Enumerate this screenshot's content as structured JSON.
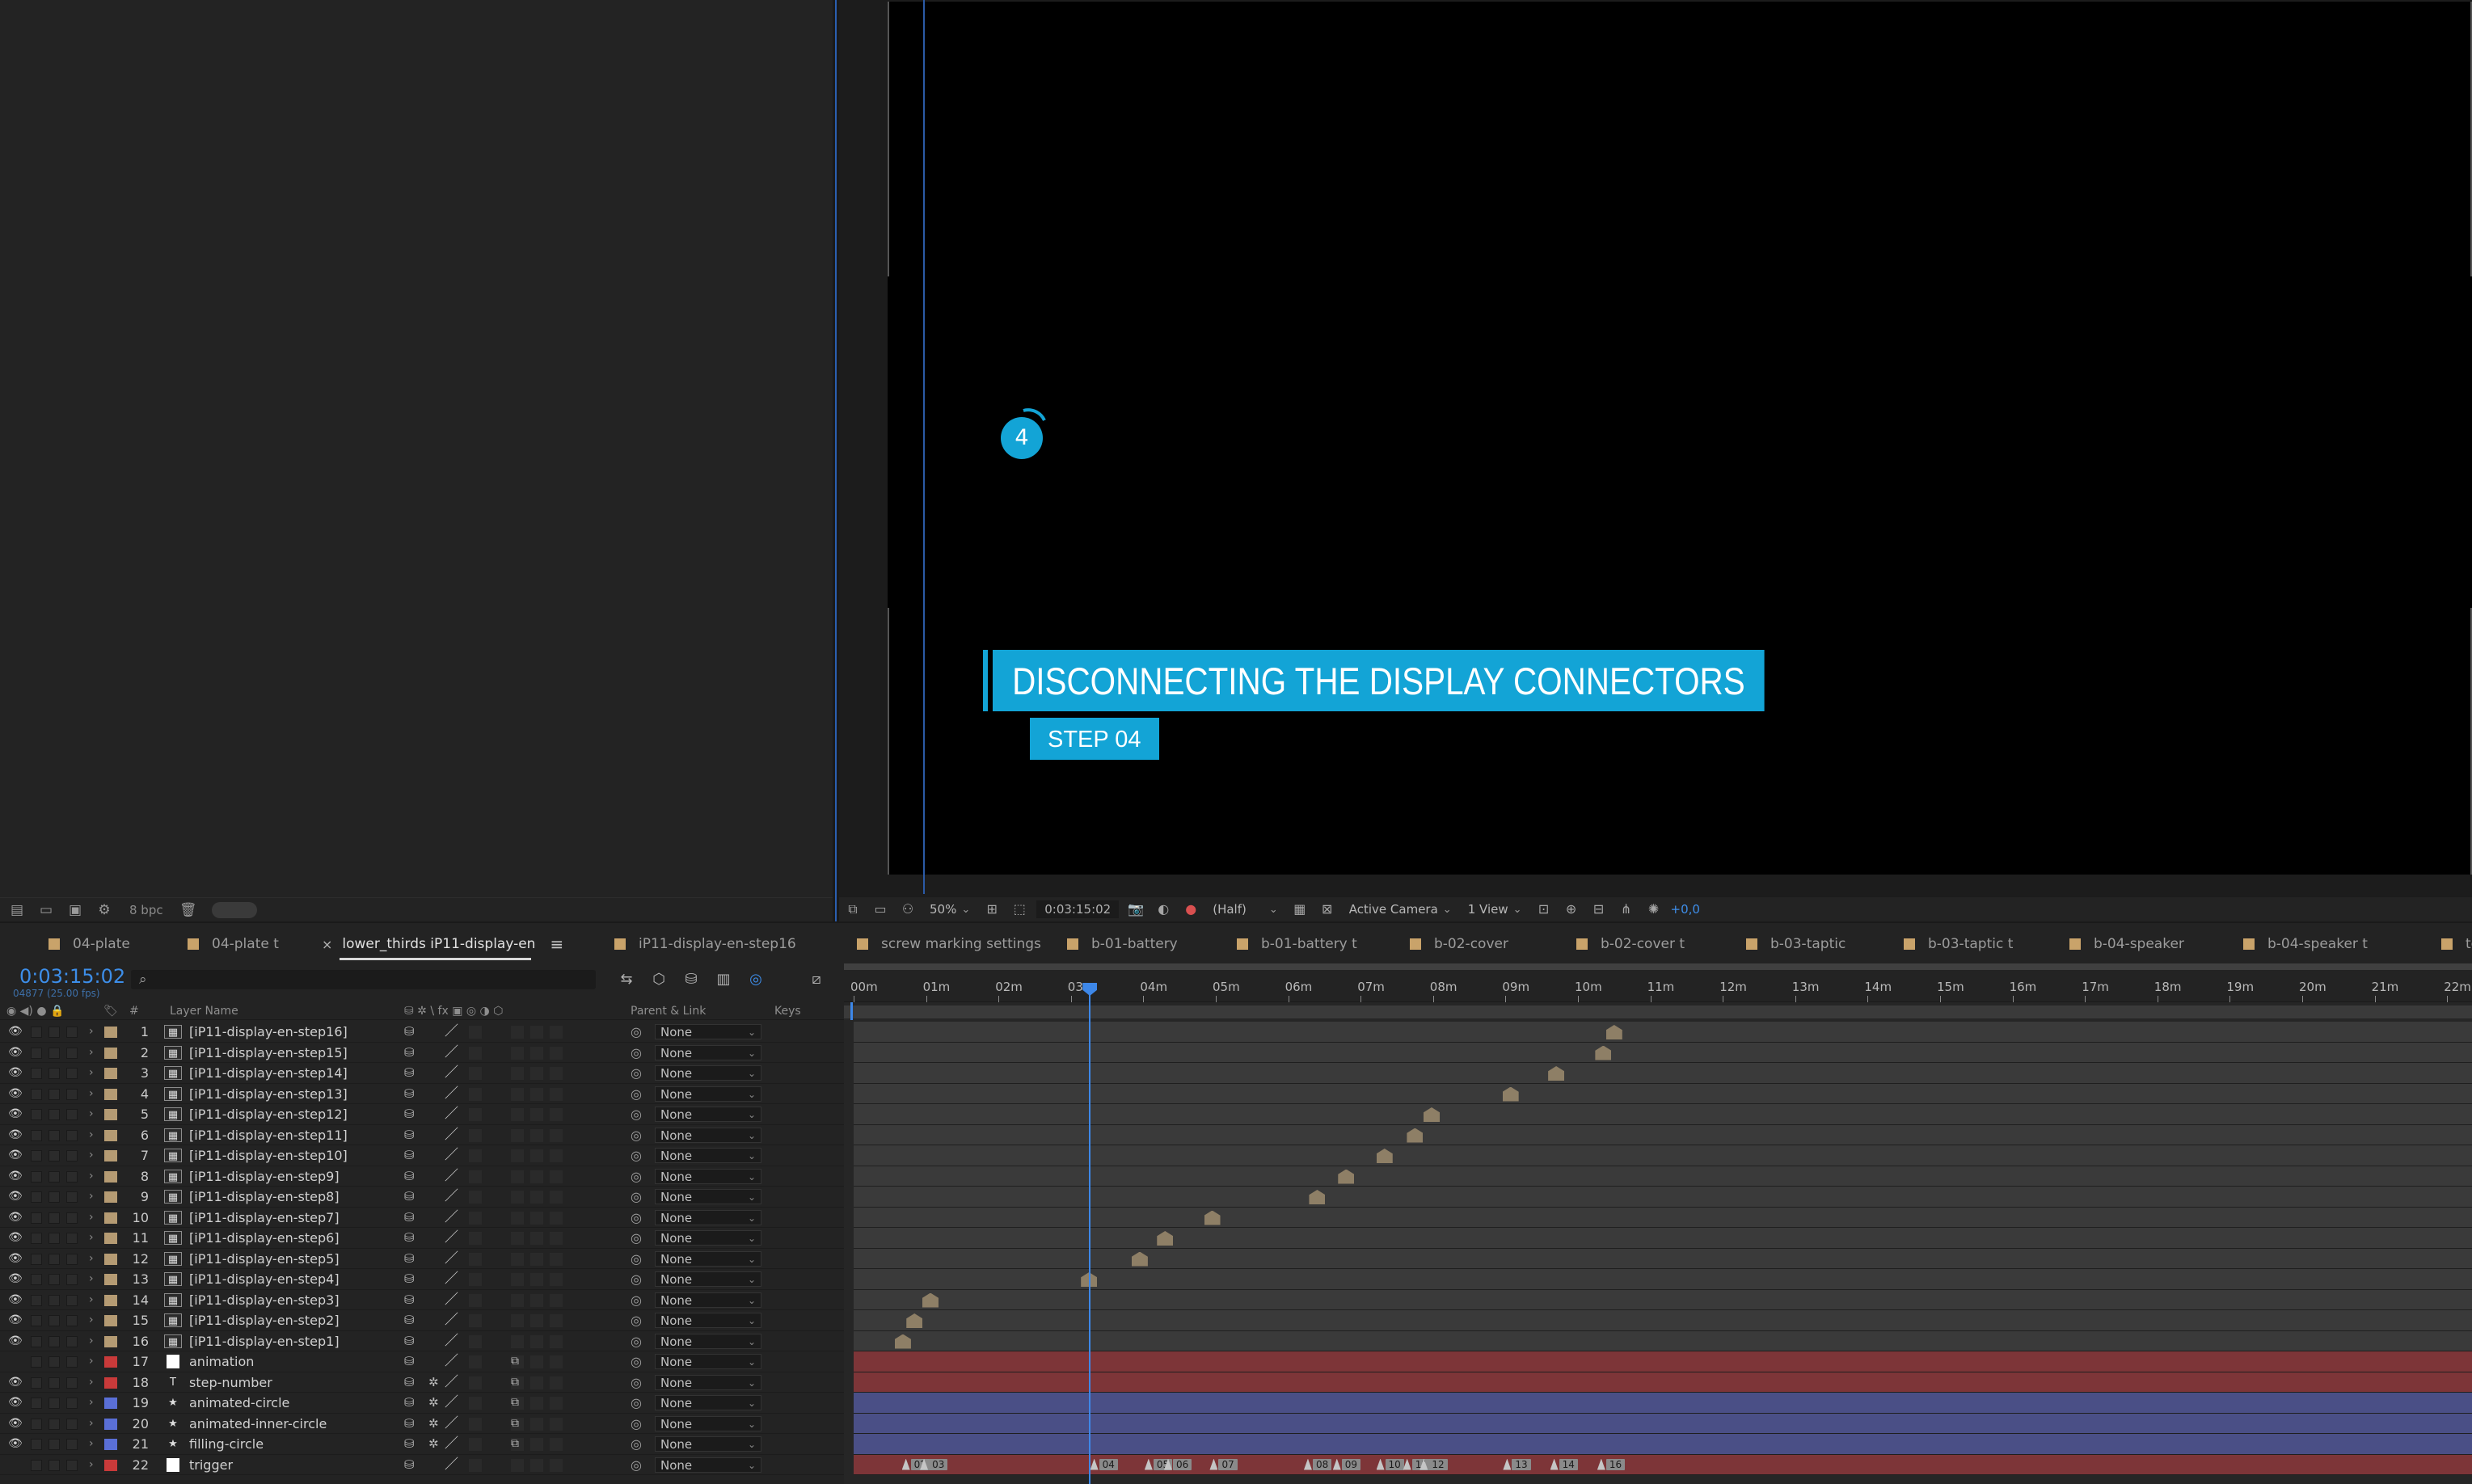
{
  "project_panel": {
    "bpc": "8 bpc",
    "icons": [
      "interpret-footage-icon",
      "new-folder-icon",
      "new-composition-icon",
      "project-settings-icon",
      "trash-icon"
    ]
  },
  "viewer": {
    "title": "DISCONNECTING THE DISPLAY CONNECTORS",
    "step_label": "STEP 04",
    "step_number": "4",
    "accent_color": "#13a4d6"
  },
  "viewer_toolbar": {
    "zoom": "50%",
    "timecode": "0:03:15:02",
    "resolution": "(Half)",
    "camera": "Active Camera",
    "views": "1 View",
    "exposure": "+0,0"
  },
  "tabs": [
    {
      "label": "04-plate",
      "chip": true
    },
    {
      "label": "04-plate t",
      "chip": true
    },
    {
      "label": "lower_thirds iP11-display-en",
      "active": true
    },
    {
      "label": "iP11-display-en-step16",
      "chip": true
    },
    {
      "label": "screw marking settings",
      "chip": true
    },
    {
      "label": "b-01-battery",
      "chip": true
    },
    {
      "label": "b-01-battery t",
      "chip": true
    },
    {
      "label": "b-02-cover",
      "chip": true
    },
    {
      "label": "b-02-cover t",
      "chip": true
    },
    {
      "label": "b-03-taptic",
      "chip": true
    },
    {
      "label": "b-03-taptic t",
      "chip": true
    },
    {
      "label": "b-04-speaker",
      "chip": true
    },
    {
      "label": "b-04-speaker t",
      "chip": true
    },
    {
      "label": "te",
      "chip": true
    }
  ],
  "timeline": {
    "timecode": "0:03:15:02",
    "fps": "04877 (25.00 fps)",
    "search_placeholder": "",
    "columns": {
      "num": "#",
      "layer_name": "Layer Name",
      "parent": "Parent & Link",
      "keys": "Keys"
    },
    "ruler": [
      "00m",
      "01m",
      "02m",
      "03m",
      "04m",
      "05m",
      "06m",
      "07m",
      "08m",
      "09m",
      "10m",
      "11m",
      "12m",
      "13m",
      "14m",
      "15m",
      "16m",
      "17m",
      "18m",
      "19m",
      "20m",
      "21m",
      "22m"
    ],
    "playhead_minutes": 3.25,
    "layers": [
      {
        "num": "1",
        "name": "[iP11-display-en-step16]",
        "type": "precomp",
        "label": "#b59b73",
        "parent": "None",
        "marker_min": 10.5
      },
      {
        "num": "2",
        "name": "[iP11-display-en-step15]",
        "type": "precomp",
        "label": "#b59b73",
        "parent": "None",
        "marker_min": 10.35
      },
      {
        "num": "3",
        "name": "[iP11-display-en-step14]",
        "type": "precomp",
        "label": "#b59b73",
        "parent": "None",
        "marker_min": 9.7
      },
      {
        "num": "4",
        "name": "[iP11-display-en-step13]",
        "type": "precomp",
        "label": "#b59b73",
        "parent": "None",
        "marker_min": 9.07
      },
      {
        "num": "5",
        "name": "[iP11-display-en-step12]",
        "type": "precomp",
        "label": "#b59b73",
        "parent": "None",
        "marker_min": 7.98
      },
      {
        "num": "6",
        "name": "[iP11-display-en-step11]",
        "type": "precomp",
        "label": "#b59b73",
        "parent": "None",
        "marker_min": 7.75
      },
      {
        "num": "7",
        "name": "[iP11-display-en-step10]",
        "type": "precomp",
        "label": "#b59b73",
        "parent": "None",
        "marker_min": 7.33
      },
      {
        "num": "8",
        "name": "[iP11-display-en-step9]",
        "type": "precomp",
        "label": "#b59b73",
        "parent": "None",
        "marker_min": 6.8
      },
      {
        "num": "9",
        "name": "[iP11-display-en-step8]",
        "type": "precomp",
        "label": "#b59b73",
        "parent": "None",
        "marker_min": 6.4
      },
      {
        "num": "10",
        "name": "[iP11-display-en-step7]",
        "type": "precomp",
        "label": "#b59b73",
        "parent": "None",
        "marker_min": 4.95
      },
      {
        "num": "11",
        "name": "[iP11-display-en-step6]",
        "type": "precomp",
        "label": "#b59b73",
        "parent": "None",
        "marker_min": 4.3
      },
      {
        "num": "12",
        "name": "[iP11-display-en-step5]",
        "type": "precomp",
        "label": "#b59b73",
        "parent": "None",
        "marker_min": 3.95
      },
      {
        "num": "13",
        "name": "[iP11-display-en-step4]",
        "type": "precomp",
        "label": "#b59b73",
        "parent": "None",
        "marker_min": 3.25
      },
      {
        "num": "14",
        "name": "[iP11-display-en-step3]",
        "type": "precomp",
        "label": "#b59b73",
        "parent": "None",
        "marker_min": 1.06
      },
      {
        "num": "15",
        "name": "[iP11-display-en-step2]",
        "type": "precomp",
        "label": "#b59b73",
        "parent": "None",
        "marker_min": 0.84
      },
      {
        "num": "16",
        "name": "[iP11-display-en-step1]",
        "type": "precomp",
        "label": "#b59b73",
        "parent": "None",
        "marker_min": 0.68
      },
      {
        "num": "17",
        "name": "animation",
        "type": "solid",
        "label": "#c93a3a",
        "parent": "None",
        "track": "red"
      },
      {
        "num": "18",
        "name": "step-number",
        "type": "text",
        "label": "#c93a3a",
        "parent": "None",
        "track": "red"
      },
      {
        "num": "19",
        "name": "animated-circle",
        "type": "shape",
        "label": "#5a6fd6",
        "parent": "None",
        "track": "blue"
      },
      {
        "num": "20",
        "name": "animated-inner-circle",
        "type": "shape",
        "label": "#5a6fd6",
        "parent": "None",
        "track": "blue"
      },
      {
        "num": "21",
        "name": "filling-circle",
        "type": "shape",
        "label": "#5a6fd6",
        "parent": "None",
        "track": "blue"
      },
      {
        "num": "22",
        "name": "trigger",
        "type": "solid-white",
        "label": "#c93a3a",
        "parent": "None",
        "track": "red"
      }
    ],
    "trigger_markers": [
      {
        "label": "02",
        "min": 0.8
      },
      {
        "label": "03",
        "min": 1.05
      },
      {
        "label": "04",
        "min": 3.4
      },
      {
        "label": "05",
        "min": 4.15
      },
      {
        "label": "06",
        "min": 4.42
      },
      {
        "label": "07",
        "min": 5.05
      },
      {
        "label": "08",
        "min": 6.35
      },
      {
        "label": "09",
        "min": 6.75
      },
      {
        "label": "10",
        "min": 7.35
      },
      {
        "label": "11",
        "min": 7.72
      },
      {
        "label": "12",
        "min": 7.95
      },
      {
        "label": "13",
        "min": 9.1
      },
      {
        "label": "14",
        "min": 9.75
      },
      {
        "label": "16",
        "min": 10.4
      }
    ]
  }
}
